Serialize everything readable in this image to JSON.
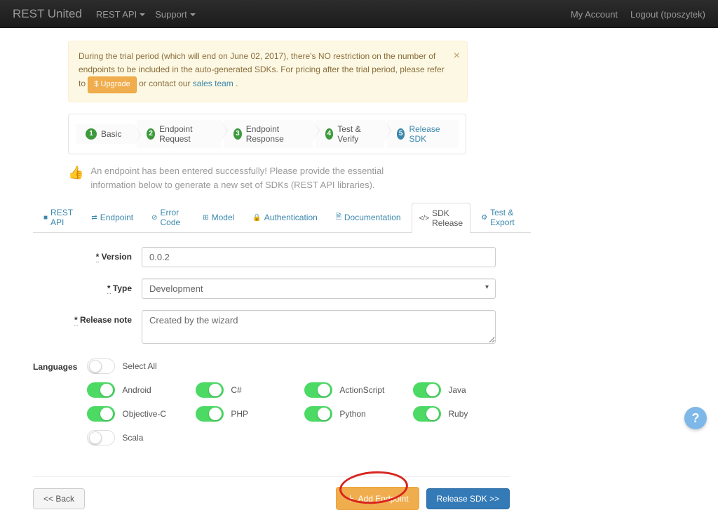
{
  "navbar": {
    "brand": "REST United",
    "left": [
      "REST API",
      "Support"
    ],
    "right_account": "My Account",
    "right_logout": "Logout (tposzytek)"
  },
  "alert": {
    "text_before": "During the trial period (which will end on June 02, 2017), there's NO restriction on the number of endpoints to be included in the auto-generated SDKs. For pricing after the trial period, please refer to ",
    "upgrade_label": "$ Upgrade",
    "text_mid": " or contact our ",
    "link_label": "sales team",
    "text_after": "."
  },
  "steps": [
    {
      "num": "1",
      "label": "Basic"
    },
    {
      "num": "2",
      "label": "Endpoint Request"
    },
    {
      "num": "3",
      "label": "Endpoint Response"
    },
    {
      "num": "4",
      "label": "Test & Verify"
    },
    {
      "num": "5",
      "label": "Release SDK"
    }
  ],
  "success_text": "An endpoint has been entered successfully! Please provide the essential information below to generate a new set of SDKs (REST API libraries).",
  "tabs": [
    {
      "icon": "■",
      "label": "REST API"
    },
    {
      "icon": "⇄",
      "label": "Endpoint"
    },
    {
      "icon": "⊘",
      "label": "Error Code"
    },
    {
      "icon": "⊞",
      "label": "Model"
    },
    {
      "icon": "🔒",
      "label": "Authentication"
    },
    {
      "icon": "🗎",
      "label": "Documentation"
    },
    {
      "icon": "</>",
      "label": "SDK Release"
    },
    {
      "icon": "⚙",
      "label": "Test & Export"
    }
  ],
  "form": {
    "version_label": "Version",
    "version_value": "0.0.2",
    "type_label": "Type",
    "type_value": "Development",
    "note_label": "Release note",
    "note_value": "Created by the wizard",
    "languages_label": "Languages",
    "select_all": "Select All",
    "langs": [
      [
        "Android",
        "C#",
        "ActionScript",
        "Java"
      ],
      [
        "Objective-C",
        "PHP",
        "Python",
        "Ruby"
      ],
      [
        "Scala"
      ]
    ],
    "lang_state": {
      "Android": true,
      "C#": true,
      "ActionScript": true,
      "Java": true,
      "Objective-C": true,
      "PHP": true,
      "Python": true,
      "Ruby": true,
      "Scala": false
    }
  },
  "buttons": {
    "back": "<< Back",
    "add": "Add Endpoint",
    "release": "Release SDK >>"
  },
  "help": "?"
}
